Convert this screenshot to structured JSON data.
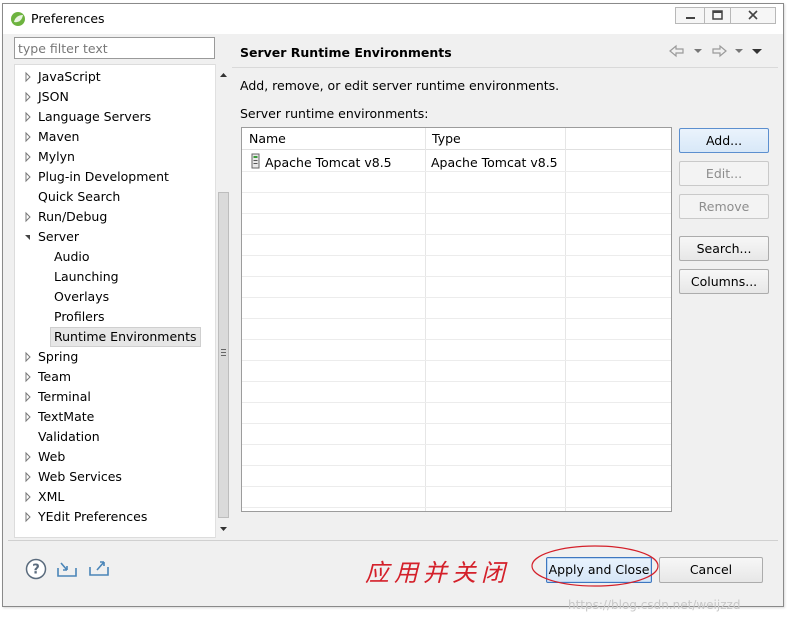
{
  "window": {
    "title": "Preferences",
    "minimize_icon": "minimize-icon",
    "maximize_icon": "maximize-icon",
    "close_icon": "close-icon"
  },
  "filter": {
    "placeholder": "type filter text",
    "value": ""
  },
  "tree": {
    "items": [
      {
        "label": "JavaScript",
        "level": 0,
        "expandable": true,
        "expanded": false
      },
      {
        "label": "JSON",
        "level": 0,
        "expandable": true,
        "expanded": false
      },
      {
        "label": "Language Servers",
        "level": 0,
        "expandable": true,
        "expanded": false
      },
      {
        "label": "Maven",
        "level": 0,
        "expandable": true,
        "expanded": false
      },
      {
        "label": "Mylyn",
        "level": 0,
        "expandable": true,
        "expanded": false
      },
      {
        "label": "Plug-in Development",
        "level": 0,
        "expandable": true,
        "expanded": false
      },
      {
        "label": "Quick Search",
        "level": 0,
        "expandable": false,
        "expanded": false
      },
      {
        "label": "Run/Debug",
        "level": 0,
        "expandable": true,
        "expanded": false
      },
      {
        "label": "Server",
        "level": 0,
        "expandable": true,
        "expanded": true
      },
      {
        "label": "Audio",
        "level": 1,
        "expandable": false,
        "expanded": false
      },
      {
        "label": "Launching",
        "level": 1,
        "expandable": false,
        "expanded": false
      },
      {
        "label": "Overlays",
        "level": 1,
        "expandable": false,
        "expanded": false
      },
      {
        "label": "Profilers",
        "level": 1,
        "expandable": false,
        "expanded": false
      },
      {
        "label": "Runtime Environments",
        "level": 1,
        "expandable": false,
        "expanded": false,
        "selected": true
      },
      {
        "label": "Spring",
        "level": 0,
        "expandable": true,
        "expanded": false
      },
      {
        "label": "Team",
        "level": 0,
        "expandable": true,
        "expanded": false
      },
      {
        "label": "Terminal",
        "level": 0,
        "expandable": true,
        "expanded": false
      },
      {
        "label": "TextMate",
        "level": 0,
        "expandable": true,
        "expanded": false
      },
      {
        "label": "Validation",
        "level": 0,
        "expandable": false,
        "expanded": false
      },
      {
        "label": "Web",
        "level": 0,
        "expandable": true,
        "expanded": false
      },
      {
        "label": "Web Services",
        "level": 0,
        "expandable": true,
        "expanded": false
      },
      {
        "label": "XML",
        "level": 0,
        "expandable": true,
        "expanded": false
      },
      {
        "label": "YEdit Preferences",
        "level": 0,
        "expandable": true,
        "expanded": false
      }
    ]
  },
  "page": {
    "title": "Server Runtime Environments",
    "description": "Add, remove, or edit server runtime environments.",
    "list_caption": "Server runtime environments:",
    "nav_icons": [
      "back-arrow-icon",
      "back-dropdown-icon",
      "forward-arrow-icon",
      "forward-dropdown-icon",
      "view-menu-icon"
    ]
  },
  "table": {
    "columns": [
      "Name",
      "Type"
    ],
    "rows": [
      {
        "name": "Apache Tomcat v8.5",
        "type": "Apache Tomcat v8.5",
        "icon": "server-icon"
      }
    ]
  },
  "buttons": {
    "add": "Add...",
    "edit": "Edit...",
    "remove": "Remove",
    "search": "Search...",
    "columns": "Columns..."
  },
  "footer": {
    "annotation": "应用并关闭",
    "apply_close": "Apply and Close",
    "cancel": "Cancel",
    "watermark": "https://blog.csdn.net/weijzzd",
    "annotation_color": "#d4202a"
  }
}
